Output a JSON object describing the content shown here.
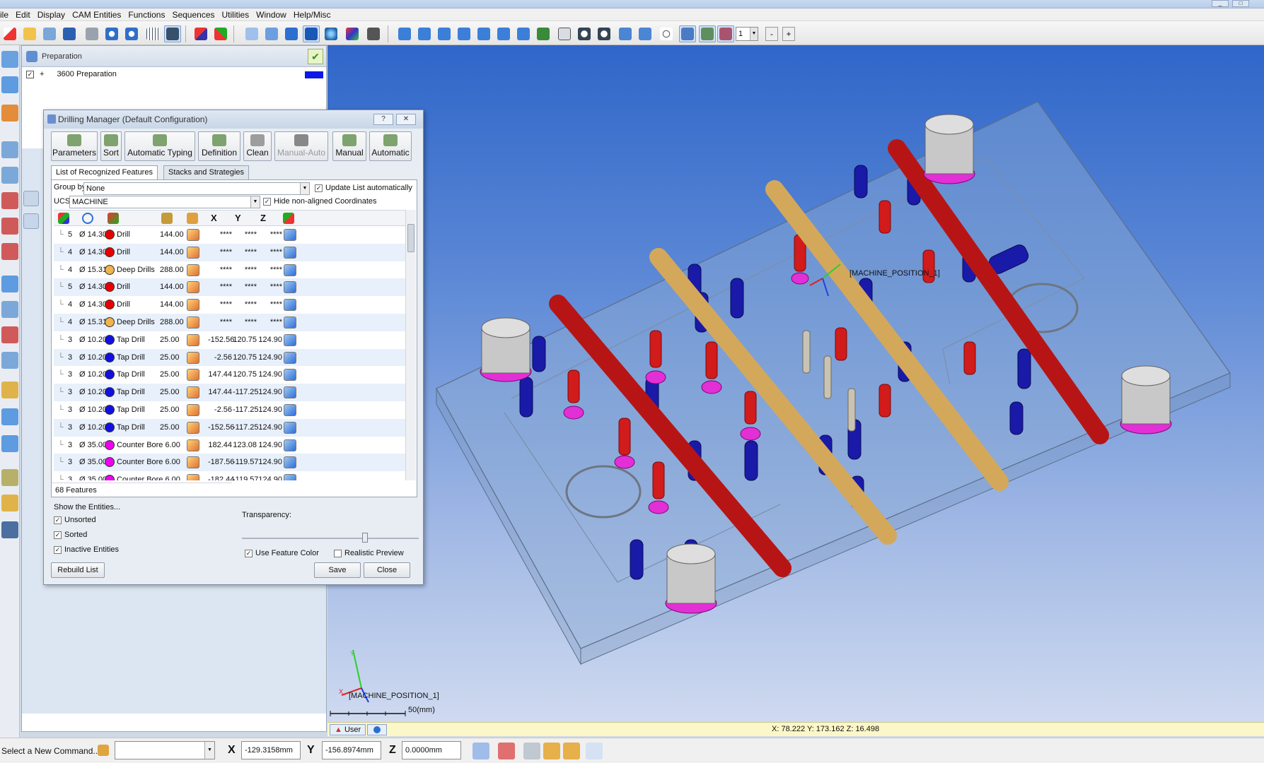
{
  "window": {
    "controls": [
      "_",
      "□"
    ]
  },
  "menu": [
    "ile",
    "Edit",
    "Display",
    "CAM Entities",
    "Functions",
    "Sequences",
    "Utilities",
    "Window",
    "Help/Misc"
  ],
  "toolbar": {
    "zoom_value": "1",
    "minus": "-",
    "plus": "+"
  },
  "tree": {
    "header": "Preparation",
    "row_label": "3600 Preparation",
    "row_checked": "✓",
    "row_color": "#0a19e8"
  },
  "dialog": {
    "title": "Drilling Manager (Default Configuration)",
    "help": "?",
    "close": "✕",
    "buttons": [
      {
        "label": "Parameters",
        "icon": "parameters-icon",
        "enabled": true
      },
      {
        "label": "Sort",
        "icon": "sort-icon",
        "enabled": true
      },
      {
        "label": "Automatic Typing",
        "icon": "auto-typing-icon",
        "enabled": true
      },
      {
        "label": "Definition",
        "icon": "definition-icon",
        "enabled": true
      },
      {
        "label": "Clean",
        "icon": "clean-icon",
        "enabled": true
      },
      {
        "label": "Manual-Auto",
        "icon": "manual-auto-icon",
        "enabled": false
      },
      {
        "label": "Manual",
        "icon": "manual-icon",
        "enabled": true
      },
      {
        "label": "Automatic",
        "icon": "automatic-icon",
        "enabled": true
      }
    ],
    "tabs": [
      "List of Recognized Features",
      "Stacks and Strategies"
    ],
    "group_by_label": "Group by",
    "group_by_value": "None",
    "update_list": "Update List automatically",
    "ucs_label": "UCS:",
    "ucs_value": "MACHINE",
    "hide_nonaligned": "Hide non-aligned Coordinates",
    "columns": {
      "x": "X",
      "y": "Y",
      "z": "Z"
    },
    "rows": [
      {
        "n": "5",
        "dia": "Ø 14.30",
        "color": "#e80000",
        "type": "Drill",
        "depth": "144.00",
        "x": "****",
        "y": "****",
        "z": "****"
      },
      {
        "n": "4",
        "dia": "Ø 14.30",
        "color": "#e80000",
        "type": "Drill",
        "depth": "144.00",
        "x": "****",
        "y": "****",
        "z": "****"
      },
      {
        "n": "4",
        "dia": "Ø 15.31",
        "color": "#f0b44c",
        "type": "Deep Drills",
        "depth": "288.00",
        "x": "****",
        "y": "****",
        "z": "****"
      },
      {
        "n": "5",
        "dia": "Ø 14.30",
        "color": "#e80000",
        "type": "Drill",
        "depth": "144.00",
        "x": "****",
        "y": "****",
        "z": "****"
      },
      {
        "n": "4",
        "dia": "Ø 14.30",
        "color": "#e80000",
        "type": "Drill",
        "depth": "144.00",
        "x": "****",
        "y": "****",
        "z": "****"
      },
      {
        "n": "4",
        "dia": "Ø 15.31",
        "color": "#f0b44c",
        "type": "Deep Drills",
        "depth": "288.00",
        "x": "****",
        "y": "****",
        "z": "****"
      },
      {
        "n": "3",
        "dia": "Ø 10.20",
        "color": "#1010e0",
        "type": "Tap Drill",
        "depth": "25.00",
        "x": "-152.56",
        "y": "120.75",
        "z": "124.90"
      },
      {
        "n": "3",
        "dia": "Ø 10.20",
        "color": "#1010e0",
        "type": "Tap Drill",
        "depth": "25.00",
        "x": "-2.56",
        "y": "120.75",
        "z": "124.90"
      },
      {
        "n": "3",
        "dia": "Ø 10.20",
        "color": "#1010e0",
        "type": "Tap Drill",
        "depth": "25.00",
        "x": "147.44",
        "y": "120.75",
        "z": "124.90"
      },
      {
        "n": "3",
        "dia": "Ø 10.20",
        "color": "#1010e0",
        "type": "Tap Drill",
        "depth": "25.00",
        "x": "147.44",
        "y": "-117.25",
        "z": "124.90"
      },
      {
        "n": "3",
        "dia": "Ø 10.20",
        "color": "#1010e0",
        "type": "Tap Drill",
        "depth": "25.00",
        "x": "-2.56",
        "y": "-117.25",
        "z": "124.90"
      },
      {
        "n": "3",
        "dia": "Ø 10.20",
        "color": "#1010e0",
        "type": "Tap Drill",
        "depth": "25.00",
        "x": "-152.56",
        "y": "-117.25",
        "z": "124.90"
      },
      {
        "n": "3",
        "dia": "Ø 35.00",
        "color": "#ee00ee",
        "type": "Counter Bore 6.00",
        "depth": "",
        "x": "182.44",
        "y": "123.08",
        "z": "124.90"
      },
      {
        "n": "3",
        "dia": "Ø 35.00",
        "color": "#ee00ee",
        "type": "Counter Bore 6.00",
        "depth": "",
        "x": "-187.56",
        "y": "-119.57",
        "z": "124.90"
      },
      {
        "n": "3",
        "dia": "Ø 35.00",
        "color": "#ee00ee",
        "type": "Counter Bore 6.00",
        "depth": "",
        "x": "-182.44",
        "y": "-119.57",
        "z": "124.90"
      }
    ],
    "feature_count": "68 Features",
    "show_entities": "Show the Entities...",
    "unsorted": "Unsorted",
    "sorted": "Sorted",
    "inactive": "Inactive Entities",
    "transparency_label": "Transparency:",
    "transparency_value": 0.75,
    "use_feature_color": "Use Feature Color",
    "realistic_preview": "Realistic Preview",
    "rebuild": "Rebuild List",
    "save": "Save",
    "close_btn": "Close"
  },
  "viewport": {
    "machine_label_top": "[MACHINE_POSITION_1]",
    "machine_label_bottom": "[MACHINE_POSITION_1]",
    "axis_x": "X",
    "axis_y": "Y",
    "axis_z": "Z",
    "scale": "50(mm)",
    "status_user": "User",
    "status_coords": "X: 78.222  Y: 173.162  Z: 16.498"
  },
  "command": {
    "prompt": "Select a New Command...",
    "x_label": "X",
    "x_value": "-129.3158mm",
    "y_label": "Y",
    "y_value": "-156.8974mm",
    "z_label": "Z",
    "z_value": "0.0000mm"
  }
}
